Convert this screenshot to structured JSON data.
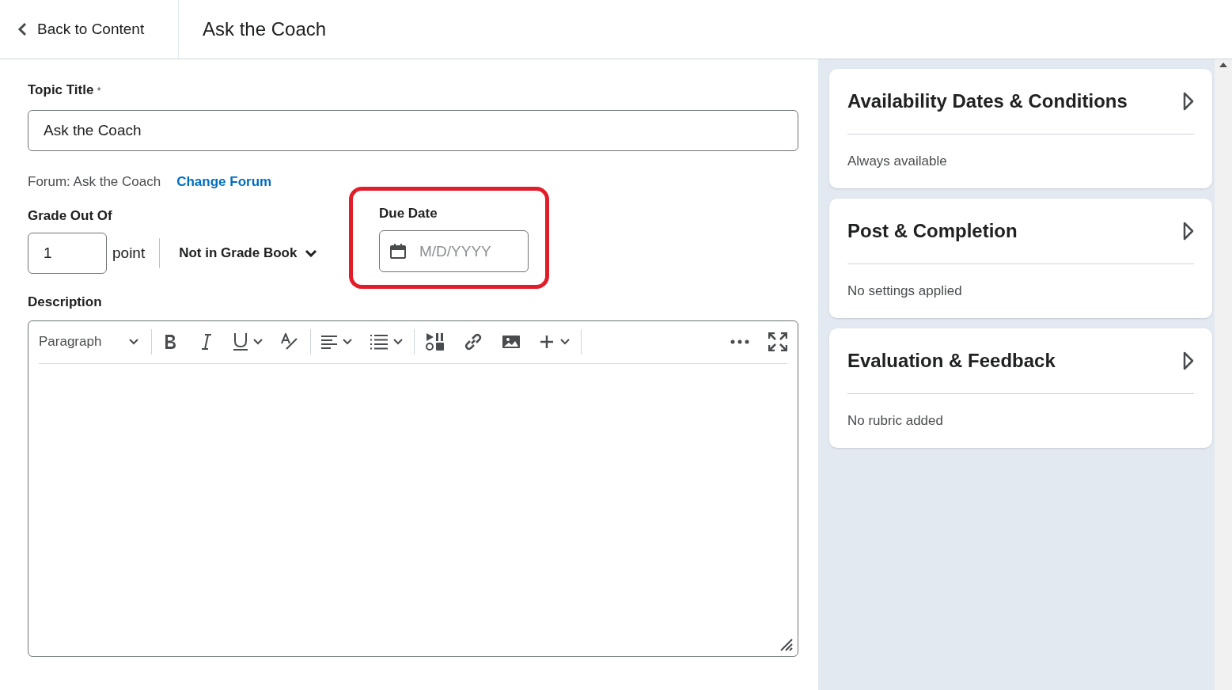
{
  "header": {
    "back_link": "Back to Content",
    "title": "Ask the Coach"
  },
  "topic_title": {
    "label": "Topic Title",
    "required_mark": "*",
    "value": "Ask the Coach"
  },
  "forum": {
    "text": "Forum: Ask the Coach",
    "link": "Change Forum"
  },
  "grade": {
    "label": "Grade Out Of",
    "value": "1",
    "unit": "point",
    "grade_book": "Not in Grade Book"
  },
  "due_date": {
    "label": "Due Date",
    "placeholder": "M/D/YYYY",
    "highlighted": true
  },
  "description": {
    "label": "Description",
    "block_format": "Paragraph"
  },
  "panels": [
    {
      "title": "Availability Dates & Conditions",
      "summary": "Always available"
    },
    {
      "title": "Post & Completion",
      "summary": "No settings applied"
    },
    {
      "title": "Evaluation & Feedback",
      "summary": "No rubric added"
    }
  ]
}
